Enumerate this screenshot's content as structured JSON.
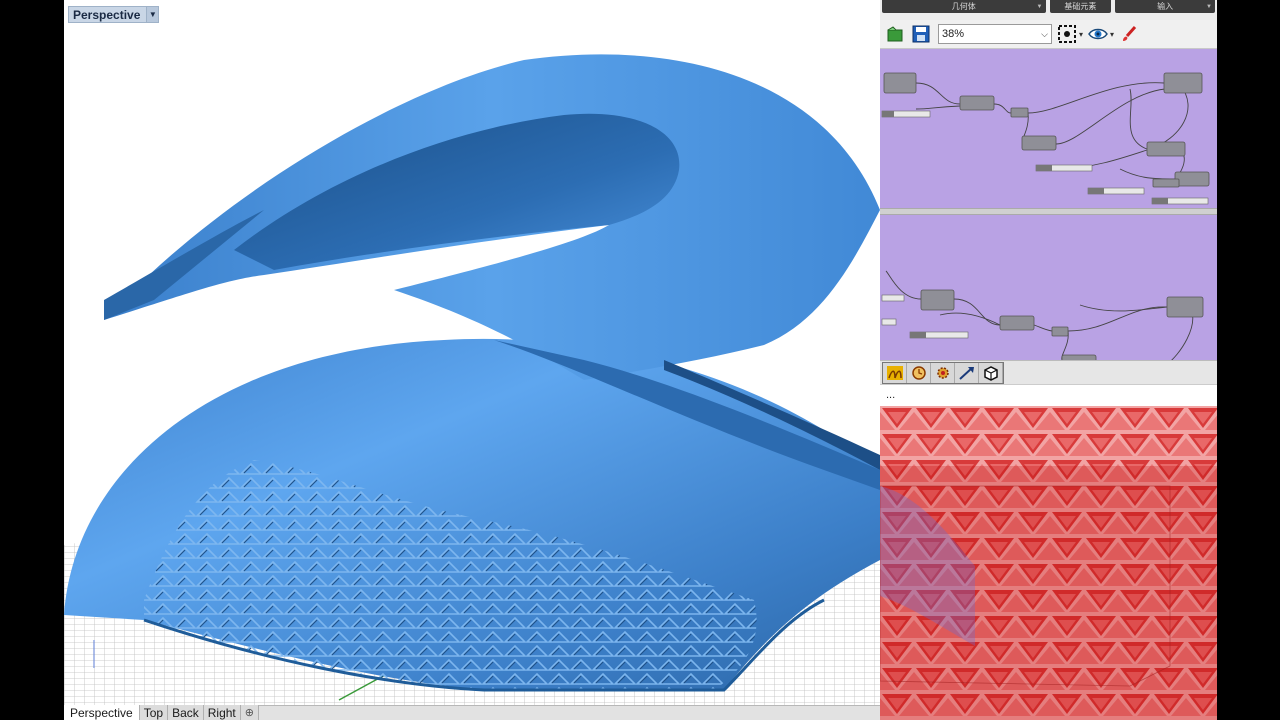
{
  "viewport": {
    "title": "Perspective",
    "dropdown_icon": "triangle-down-icon",
    "colors": {
      "surface": "#4a90e2",
      "surface_dark": "#1f5c99",
      "grid": "#b8b8b8",
      "background": "#ffffff"
    }
  },
  "view_tabs": [
    {
      "label": "Perspective",
      "active": true
    },
    {
      "label": "Top",
      "active": false
    },
    {
      "label": "Back",
      "active": false
    },
    {
      "label": "Right",
      "active": false
    }
  ],
  "add_tab_icon": "plus-icon",
  "grasshopper": {
    "category_tabs": [
      "几何体",
      "基础元素",
      "输入"
    ],
    "toolbar": {
      "open_icon": "open-file-icon",
      "save_icon": "save-icon",
      "zoom_value": "38%",
      "zoom_dropdown_icon": "chevron-down-icon",
      "sketch_icon": "sketch-selection-icon",
      "preview_icon": "eye-icon",
      "paint_icon": "paint-brush-icon"
    },
    "canvas_color": "#b9a2e4",
    "component_color": "#8f8f97",
    "bottom_icons": [
      "spectrum-icon",
      "timer-icon",
      "gear-icon",
      "arrow-icon",
      "box-icon"
    ],
    "status_text": "...",
    "preview_color": "#d42a2a"
  }
}
